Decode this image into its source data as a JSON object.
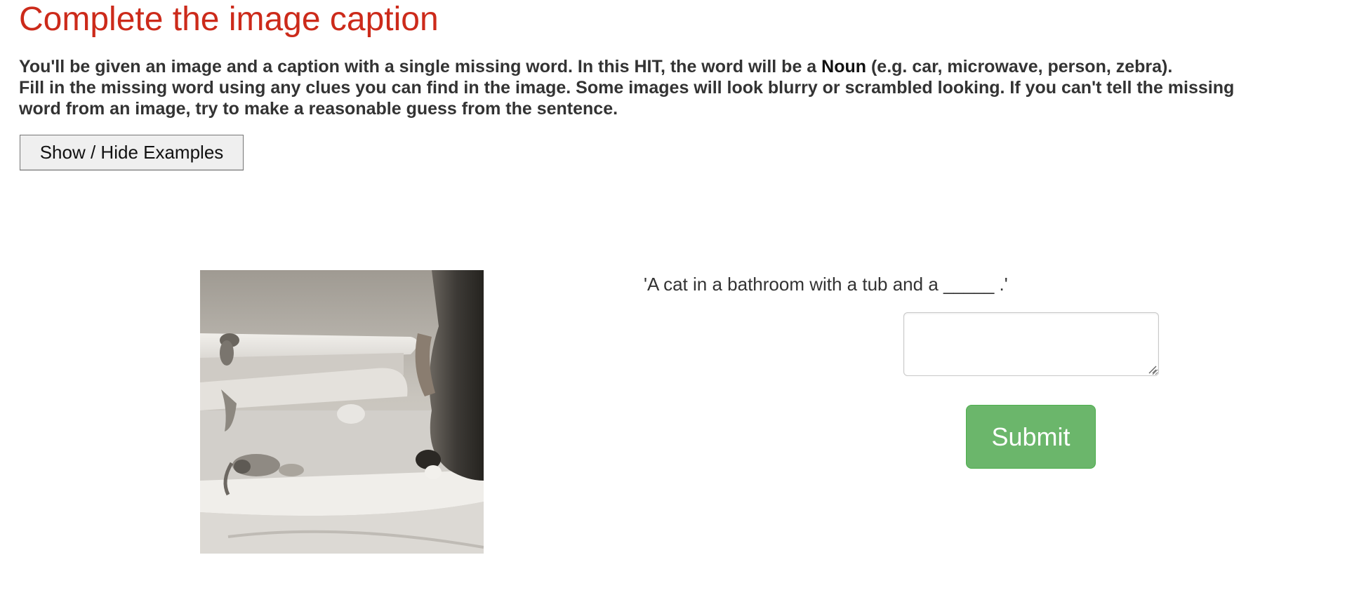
{
  "page": {
    "title": "Complete the image caption"
  },
  "instructions": {
    "line1_prefix": "You'll be given an image and a caption with a single missing word. In this HIT, the word will be a ",
    "line1_emphasis": "Noun",
    "line1_suffix": " (e.g. car, microwave, person, zebra).",
    "line2": "Fill in the missing word using any clues you can find in the image. Some images will look blurry or scrambled looking. If you can't tell the missing",
    "line3": "word from an image, try to make a reasonable guess from the sentence."
  },
  "examples_toggle": {
    "label": "Show / Hide Examples"
  },
  "task": {
    "caption": "'A cat in a bathroom with a tub and a _____ .'",
    "answer_value": "",
    "submit_label": "Submit"
  },
  "colors": {
    "title": "#cc2a1a",
    "submit_bg": "#6bb66b",
    "text": "#333333"
  }
}
